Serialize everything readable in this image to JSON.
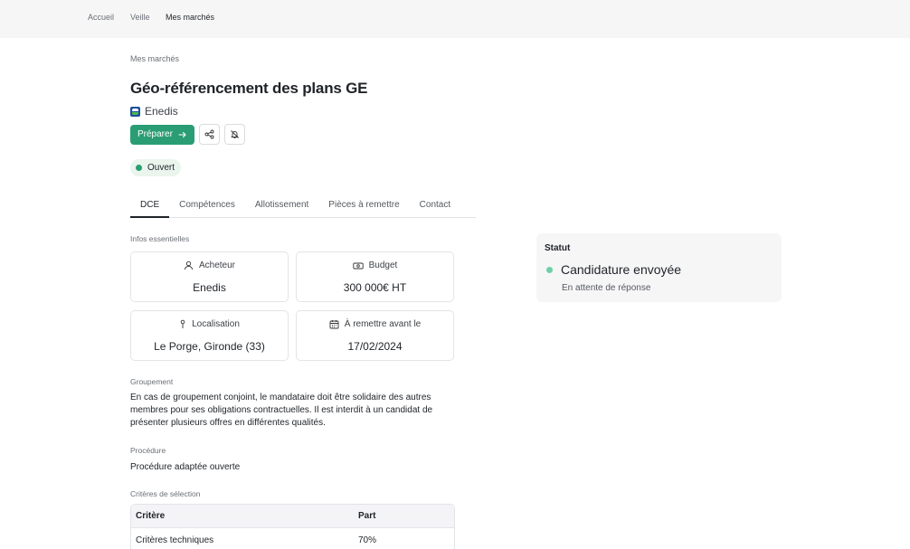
{
  "nav": {
    "items": [
      {
        "label": "Accueil",
        "active": false
      },
      {
        "label": "Veille",
        "active": false
      },
      {
        "label": "Mes marchés",
        "active": true
      }
    ]
  },
  "breadcrumb": "Mes marchés",
  "title": "Géo-référencement des plans GE",
  "buyer": {
    "name": "Enedis",
    "logo": "enedis-logo"
  },
  "actions": {
    "prepare_label": "Préparer",
    "prepare_icon": "arrow-right-icon",
    "share_icon": "share-icon",
    "alert_icon": "bell-off-icon"
  },
  "status_badge": {
    "label": "Ouvert",
    "color": "#2a9d74"
  },
  "tabs": [
    {
      "label": "DCE",
      "active": true
    },
    {
      "label": "Compétences",
      "active": false
    },
    {
      "label": "Allotissement",
      "active": false
    },
    {
      "label": "Pièces à remettre",
      "active": false
    },
    {
      "label": "Contact",
      "active": false
    }
  ],
  "infos": {
    "section_label": "Infos essentielles",
    "cards": [
      {
        "label": "Acheteur",
        "value": "Enedis",
        "icon": "user-icon"
      },
      {
        "label": "Budget",
        "value": "300 000€ HT",
        "icon": "banknote-icon"
      },
      {
        "label": "Localisation",
        "value": "Le Porge, Gironde (33)",
        "icon": "pin-icon"
      },
      {
        "label": "À remettre avant le",
        "value": "17/02/2024",
        "icon": "calendar-icon"
      }
    ]
  },
  "groupement": {
    "label": "Groupement",
    "text": "En cas de groupement conjoint, le mandataire doit être solidaire des autres membres pour ses obligations contractuelles. Il est interdit à un candidat de présenter plusieurs offres en différentes qualités."
  },
  "procedure": {
    "label": "Procédure",
    "text": "Procédure adaptée ouverte"
  },
  "criteres": {
    "label": "Critères de sélection",
    "headers": [
      "Critère",
      "Part"
    ],
    "rows": [
      [
        "Critères techniques",
        "70%"
      ]
    ]
  },
  "status_card": {
    "title": "Statut",
    "value": "Candidature envoyée",
    "subtitle": "En attente de réponse",
    "dot_color": "#6fcfa7"
  },
  "colors": {
    "accent": "#2a9d74",
    "nav_bg": "#f6f6f7"
  }
}
